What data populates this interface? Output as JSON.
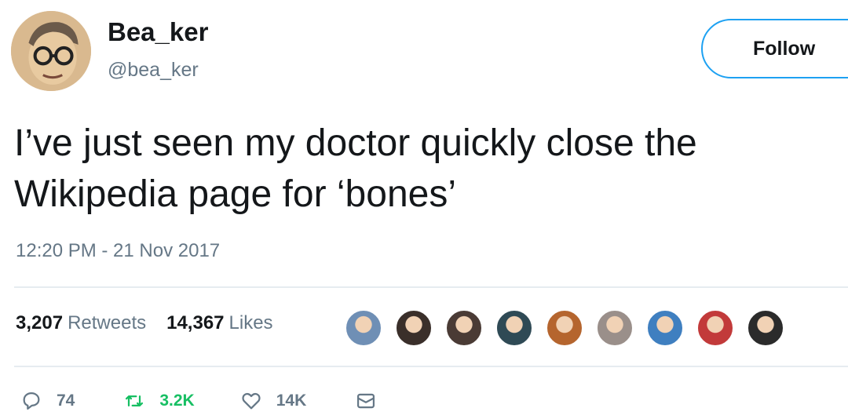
{
  "user": {
    "display_name": "Bea_ker",
    "handle": "@bea_ker",
    "avatar_icon": "cartoon-face-avatar"
  },
  "follow_button": {
    "label": "Follow"
  },
  "tweet": {
    "text": "I’ve just seen my doctor quickly close the\nWikipedia page for ‘bones’",
    "timestamp": "12:20 PM - 21 Nov 2017"
  },
  "stats": {
    "retweets_count": "3,207",
    "retweets_label": "Retweets",
    "likes_count": "14,367",
    "likes_label": "Likes"
  },
  "likers": [
    {
      "icon": "liker-avatar",
      "color": "#6f8fb5"
    },
    {
      "icon": "liker-avatar",
      "color": "#3a2f2a"
    },
    {
      "icon": "liker-avatar",
      "color": "#4a3b35"
    },
    {
      "icon": "liker-avatar",
      "color": "#2f4a55"
    },
    {
      "icon": "liker-avatar",
      "color": "#b5652e"
    },
    {
      "icon": "liker-avatar",
      "color": "#9a8f8a"
    },
    {
      "icon": "liker-avatar",
      "color": "#3f7fc0"
    },
    {
      "icon": "liker-avatar",
      "color": "#c23a3a"
    },
    {
      "icon": "liker-avatar",
      "color": "#2b2b2b"
    }
  ],
  "actions": {
    "reply": {
      "icon": "reply-icon",
      "count": "74"
    },
    "retweet": {
      "icon": "retweet-icon",
      "count": "3.2K"
    },
    "like": {
      "icon": "heart-icon",
      "count": "14K"
    },
    "message": {
      "icon": "envelope-icon"
    }
  },
  "colors": {
    "accent": "#1da1f2",
    "text": "#14171a",
    "muted": "#657786",
    "retweet": "#17bf63"
  }
}
